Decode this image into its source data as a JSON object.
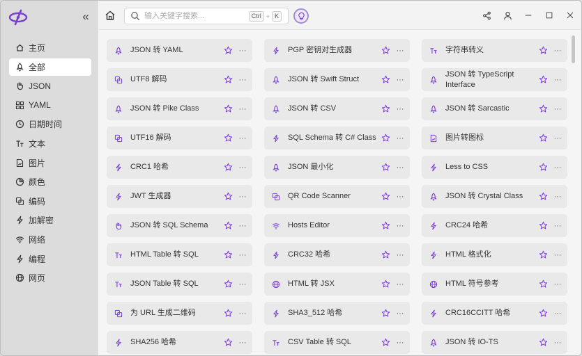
{
  "app": {
    "brand_color": "#7b3fcf",
    "accent": "#a58bd8"
  },
  "sidebar": {
    "collapse_glyph": "«",
    "items": [
      {
        "label": "主页",
        "icon": "home-icon",
        "active": false
      },
      {
        "label": "全部",
        "icon": "rocket-icon",
        "active": true
      },
      {
        "label": "JSON",
        "icon": "hand-icon",
        "active": false
      },
      {
        "label": "YAML",
        "icon": "grid-icon",
        "active": false
      },
      {
        "label": "日期时间",
        "icon": "clock-icon",
        "active": false
      },
      {
        "label": "文本",
        "icon": "text-icon",
        "active": false
      },
      {
        "label": "图片",
        "icon": "image-icon",
        "active": false
      },
      {
        "label": "颜色",
        "icon": "palette-icon",
        "active": false
      },
      {
        "label": "编码",
        "icon": "encode-icon",
        "active": false
      },
      {
        "label": "加解密",
        "icon": "bolt-icon",
        "active": false
      },
      {
        "label": "网络",
        "icon": "wifi-icon",
        "active": false
      },
      {
        "label": "编程",
        "icon": "bolt-icon",
        "active": false
      },
      {
        "label": "网页",
        "icon": "globe-icon",
        "active": false
      }
    ]
  },
  "topbar": {
    "search_placeholder": "输入关键字搜索...",
    "shortcut_key1": "Ctrl",
    "shortcut_plus": "+",
    "shortcut_key2": "K"
  },
  "tools": [
    {
      "label": "JSON 转 YAML",
      "icon": "rocket-icon"
    },
    {
      "label": "PGP 密钥对生成器",
      "icon": "bolt-icon"
    },
    {
      "label": "字符串转义",
      "icon": "text-icon"
    },
    {
      "label": "UTF8 解码",
      "icon": "encode-icon"
    },
    {
      "label": "JSON 转 Swift Struct",
      "icon": "rocket-icon"
    },
    {
      "label": "JSON 转 TypeScript Interface",
      "icon": "rocket-icon"
    },
    {
      "label": "JSON 转 Pike Class",
      "icon": "rocket-icon"
    },
    {
      "label": "JSON 转 CSV",
      "icon": "rocket-icon"
    },
    {
      "label": "JSON 转 Sarcastic",
      "icon": "rocket-icon"
    },
    {
      "label": "UTF16 解码",
      "icon": "encode-icon"
    },
    {
      "label": "SQL Schema 转 C# Class",
      "icon": "bolt-icon"
    },
    {
      "label": "图片转图标",
      "icon": "image-icon"
    },
    {
      "label": "CRC1 哈希",
      "icon": "bolt-icon"
    },
    {
      "label": "JSON 最小化",
      "icon": "rocket-icon"
    },
    {
      "label": "Less to CSS",
      "icon": "bolt-icon"
    },
    {
      "label": "JWT 生成器",
      "icon": "bolt-icon"
    },
    {
      "label": "QR Code Scanner",
      "icon": "encode-icon"
    },
    {
      "label": "JSON 转 Crystal Class",
      "icon": "rocket-icon"
    },
    {
      "label": "JSON 转 SQL Schema",
      "icon": "hand-icon"
    },
    {
      "label": "Hosts Editor",
      "icon": "wifi-icon"
    },
    {
      "label": "CRC24 哈希",
      "icon": "bolt-icon"
    },
    {
      "label": "HTML Table 转 SQL",
      "icon": "text-icon"
    },
    {
      "label": "CRC32 哈希",
      "icon": "bolt-icon"
    },
    {
      "label": "HTML 格式化",
      "icon": "bolt-icon"
    },
    {
      "label": "JSON Table 转 SQL",
      "icon": "text-icon"
    },
    {
      "label": "HTML 转 JSX",
      "icon": "globe-icon"
    },
    {
      "label": "HTML 符号参考",
      "icon": "globe-icon"
    },
    {
      "label": "为 URL 生成二维码",
      "icon": "encode-icon"
    },
    {
      "label": "SHA3_512 哈希",
      "icon": "bolt-icon"
    },
    {
      "label": "CRC16CCITT 哈希",
      "icon": "bolt-icon"
    },
    {
      "label": "SHA256 哈希",
      "icon": "bolt-icon"
    },
    {
      "label": "CSV Table 转 SQL",
      "icon": "text-icon"
    },
    {
      "label": "JSON 转 IO-TS",
      "icon": "rocket-icon"
    }
  ],
  "more_glyph": "···"
}
